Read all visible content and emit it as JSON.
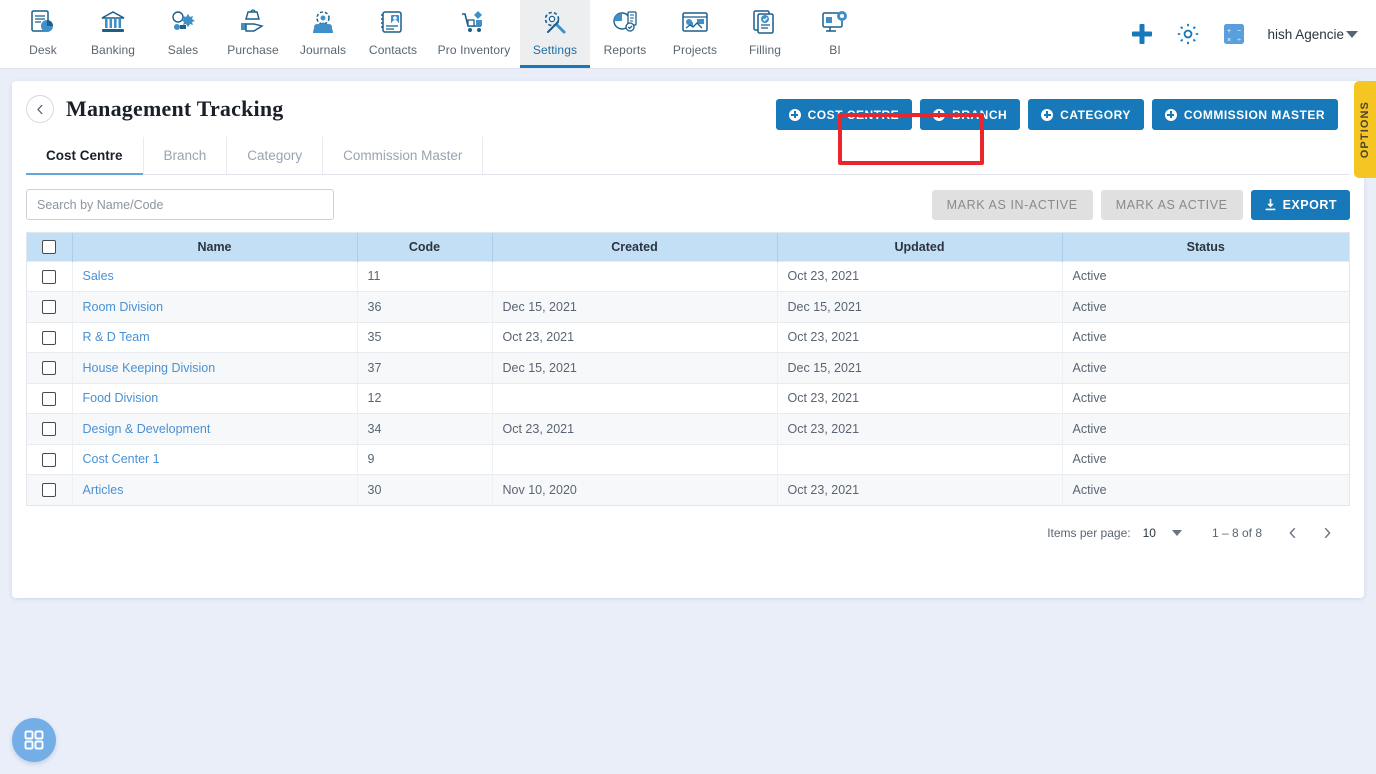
{
  "topnav": {
    "items": [
      {
        "label": "Desk",
        "icon": "desk-dashboard-icon",
        "active": false
      },
      {
        "label": "Banking",
        "icon": "bank-building-icon",
        "active": false
      },
      {
        "label": "Sales",
        "icon": "sales-icon",
        "active": false
      },
      {
        "label": "Purchase",
        "icon": "purchase-bag-icon",
        "active": false
      },
      {
        "label": "Journals",
        "icon": "journals-gear-people-icon",
        "active": false
      },
      {
        "label": "Contacts",
        "icon": "contacts-card-icon",
        "active": false
      },
      {
        "label": "Pro Inventory",
        "icon": "inventory-cart-icon",
        "active": false
      },
      {
        "label": "Settings",
        "icon": "settings-tools-icon",
        "active": true
      },
      {
        "label": "Reports",
        "icon": "reports-piechart-icon",
        "active": false
      },
      {
        "label": "Projects",
        "icon": "projects-board-icon",
        "active": false
      },
      {
        "label": "Filling",
        "icon": "filling-documents-icon",
        "active": false
      },
      {
        "label": "BI",
        "icon": "bi-monitor-icon",
        "active": false
      }
    ],
    "add_icon": "plus-icon",
    "settings_icon": "gear-icon",
    "calculator_icon": "calculator-icon",
    "org_name": "hish Agencie",
    "org_caret_icon": "chevron-down-icon"
  },
  "options_tab": {
    "label": "OPTIONS"
  },
  "page": {
    "back_icon": "chevron-left-icon",
    "title": "Management Tracking",
    "actions": [
      {
        "label": "COST CENTRE",
        "icon": "plus-circle-icon",
        "highlighted": true
      },
      {
        "label": "BRANCH",
        "icon": "plus-circle-icon",
        "highlighted": false
      },
      {
        "label": "CATEGORY",
        "icon": "plus-circle-icon",
        "highlighted": false
      },
      {
        "label": "COMMISSION MASTER",
        "icon": "plus-circle-icon",
        "highlighted": false
      }
    ]
  },
  "tabs": [
    {
      "label": "Cost Centre",
      "active": true
    },
    {
      "label": "Branch",
      "active": false
    },
    {
      "label": "Category",
      "active": false
    },
    {
      "label": "Commission Master",
      "active": false
    }
  ],
  "toolbar": {
    "search_placeholder": "Search by Name/Code",
    "search_value": "",
    "mark_inactive_label": "MARK AS IN-ACTIVE",
    "mark_active_label": "MARK AS ACTIVE",
    "export_label": "EXPORT",
    "export_icon": "download-icon"
  },
  "table": {
    "select_all_icon": "checkbox-unchecked-icon",
    "columns": [
      "",
      "Name",
      "Code",
      "Created",
      "Updated",
      "Status"
    ],
    "rows": [
      {
        "name": "Sales",
        "code": "11",
        "created": "",
        "updated": "Oct 23, 2021",
        "status": "Active"
      },
      {
        "name": "Room Division",
        "code": "36",
        "created": "Dec 15, 2021",
        "updated": "Dec 15, 2021",
        "status": "Active"
      },
      {
        "name": "R & D Team",
        "code": "35",
        "created": "Oct 23, 2021",
        "updated": "Oct 23, 2021",
        "status": "Active"
      },
      {
        "name": "House Keeping Division",
        "code": "37",
        "created": "Dec 15, 2021",
        "updated": "Dec 15, 2021",
        "status": "Active"
      },
      {
        "name": "Food Division",
        "code": "12",
        "created": "",
        "updated": "Oct 23, 2021",
        "status": "Active"
      },
      {
        "name": "Design & Development",
        "code": "34",
        "created": "Oct 23, 2021",
        "updated": "Oct 23, 2021",
        "status": "Active"
      },
      {
        "name": "Cost Center 1",
        "code": "9",
        "created": "",
        "updated": "",
        "status": "Active"
      },
      {
        "name": "Articles",
        "code": "30",
        "created": "Nov 10, 2020",
        "updated": "Oct 23, 2021",
        "status": "Active"
      }
    ]
  },
  "pagination": {
    "items_per_page_label": "Items per page:",
    "items_per_page_value": "10",
    "range_label": "1 – 8 of 8",
    "prev_icon": "chevron-left-icon",
    "next_icon": "chevron-right-icon"
  },
  "fab": {
    "icon": "grid-apps-icon"
  },
  "colors": {
    "accent_blue": "#1779ba",
    "header_blue": "#c3dff5",
    "link_blue": "#4a91d4",
    "highlight_red": "#e8262b",
    "options_yellow": "#f5c523",
    "page_bg": "#e9eef9"
  }
}
